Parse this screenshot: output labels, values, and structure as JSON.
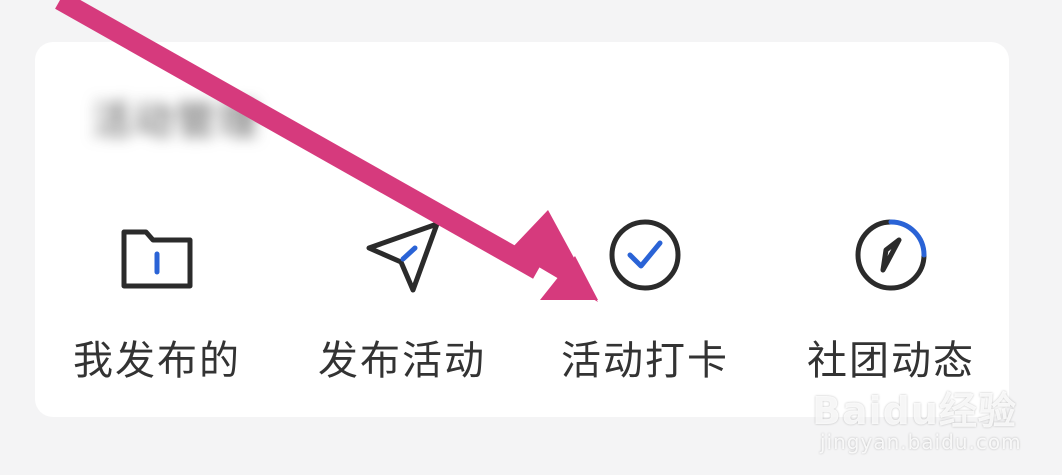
{
  "section": {
    "title": "活动管理"
  },
  "entries": [
    {
      "label": "我发布的",
      "icon": "folder-icon"
    },
    {
      "label": "发布活动",
      "icon": "paper-plane-icon"
    },
    {
      "label": "活动打卡",
      "icon": "check-circle-icon"
    },
    {
      "label": "社团动态",
      "icon": "compass-icon"
    }
  ],
  "annotation": {
    "color": "#d63a7d",
    "target": "活动打卡"
  },
  "watermark": {
    "logo": "Baidu经验",
    "url": "jingyan.baidu.com"
  },
  "colors": {
    "accent": "#2a63d6",
    "stroke": "#2b2b2b"
  }
}
